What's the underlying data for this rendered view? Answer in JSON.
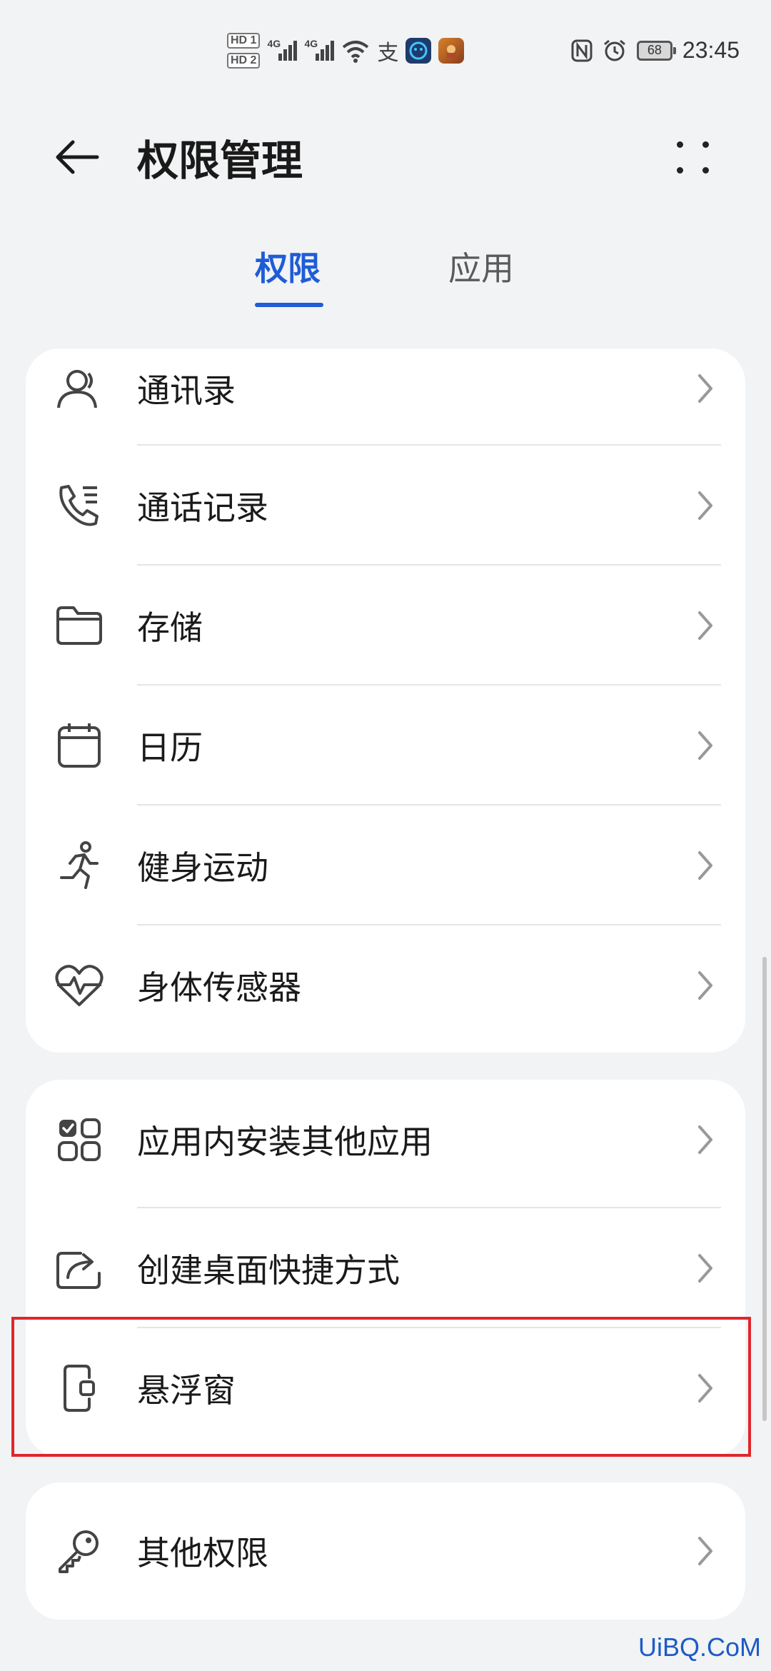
{
  "status_bar": {
    "sim1": "HD 1",
    "sim2": "HD 2",
    "network1": "4G",
    "network2": "4G",
    "time": "23:45",
    "battery": "68",
    "icons": [
      "signal-icon",
      "wifi-icon",
      "alipay-icon",
      "app-notification-icon",
      "game-notification-icon",
      "nfc-icon",
      "alarm-icon",
      "battery-icon"
    ]
  },
  "header": {
    "title": "权限管理",
    "back_icon": "arrow-left-icon",
    "more_icon": "more-dots-icon"
  },
  "tabs": [
    {
      "label": "权限",
      "active": true
    },
    {
      "label": "应用",
      "active": false
    }
  ],
  "accent_color": "#1f5cd6",
  "highlight_color": "#e0262b",
  "sections": [
    {
      "items": [
        {
          "label": "通讯录",
          "icon": "contacts-icon"
        },
        {
          "label": "通话记录",
          "icon": "call-log-icon"
        },
        {
          "label": "存储",
          "icon": "folder-icon"
        },
        {
          "label": "日历",
          "icon": "calendar-icon"
        },
        {
          "label": "健身运动",
          "icon": "running-icon"
        },
        {
          "label": "身体传感器",
          "icon": "heart-rate-icon"
        }
      ]
    },
    {
      "items": [
        {
          "label": "应用内安装其他应用",
          "icon": "install-apps-icon"
        },
        {
          "label": "创建桌面快捷方式",
          "icon": "shortcut-icon"
        },
        {
          "label": "悬浮窗",
          "icon": "floating-window-icon",
          "highlighted": true
        }
      ]
    },
    {
      "items": [
        {
          "label": "其他权限",
          "icon": "key-icon"
        }
      ]
    }
  ],
  "watermark": "UiBQ.CoM"
}
